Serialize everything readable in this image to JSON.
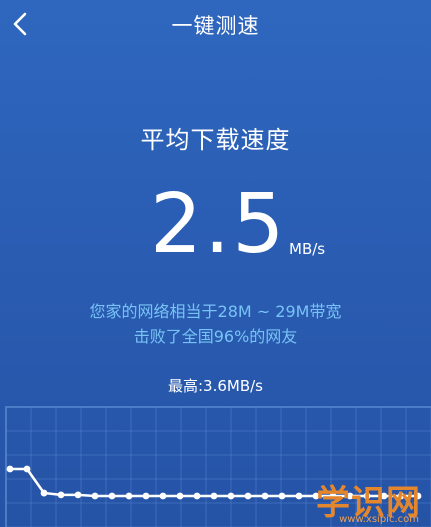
{
  "header": {
    "title": "一键测速",
    "back_icon": "chevron-left-icon"
  },
  "result": {
    "avg_label": "平均下载速度",
    "speed_value": "2.5",
    "speed_unit": "MB/s",
    "compare_line1": "您家的网络相当于28M ~ 29M带宽",
    "compare_line2": "击败了全国96%的网友",
    "max_label": "最高:3.6MB/s"
  },
  "chart_data": {
    "type": "line",
    "values": [
      1.0,
      1.0,
      0.35,
      0.3,
      0.3,
      0.27,
      0.27,
      0.27,
      0.27,
      0.27,
      0.27,
      0.27,
      0.27,
      0.27,
      0.27,
      0.27,
      0.27,
      0.27,
      0.27,
      0.27,
      0.27,
      0.27,
      0.27,
      0.27,
      0.27
    ],
    "grid": true,
    "colors": {
      "line": "#ffffff",
      "grid": "#5a88d0"
    }
  },
  "watermark": {
    "text": "学识网",
    "url": "www.xsipic.com"
  }
}
